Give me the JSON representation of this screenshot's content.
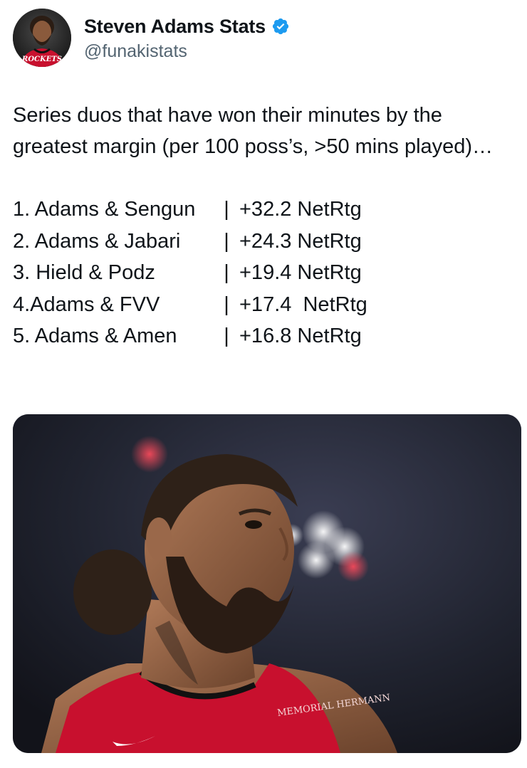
{
  "author": {
    "display_name": "Steven Adams Stats",
    "handle": "@funakistats",
    "verified": true,
    "avatar_team_text": "ROCKETS",
    "verified_color": "#1d9bf0"
  },
  "tweet": {
    "intro": "Series duos that have won their minutes by the greatest margin (per 100 poss’s, >50 mins played)…",
    "rows": [
      {
        "name": "1. Adams & Sengun",
        "sep": "|",
        "value": "+32.2 NetRtg"
      },
      {
        "name": "2. Adams & Jabari",
        "sep": "|",
        "value": "+24.3 NetRtg"
      },
      {
        "name": "3. Hield & Podz",
        "sep": "|",
        "value": "+19.4 NetRtg"
      },
      {
        "name": "4.Adams & FVV",
        "sep": "|",
        "value": "+17.4  NetRtg"
      },
      {
        "name": "5. Adams & Amen",
        "sep": "|",
        "value": "+16.8 NetRtg"
      }
    ]
  },
  "media": {
    "jersey_sponsor_text": "MEMORIAL HERMANN",
    "jersey_color": "#c8102e"
  }
}
